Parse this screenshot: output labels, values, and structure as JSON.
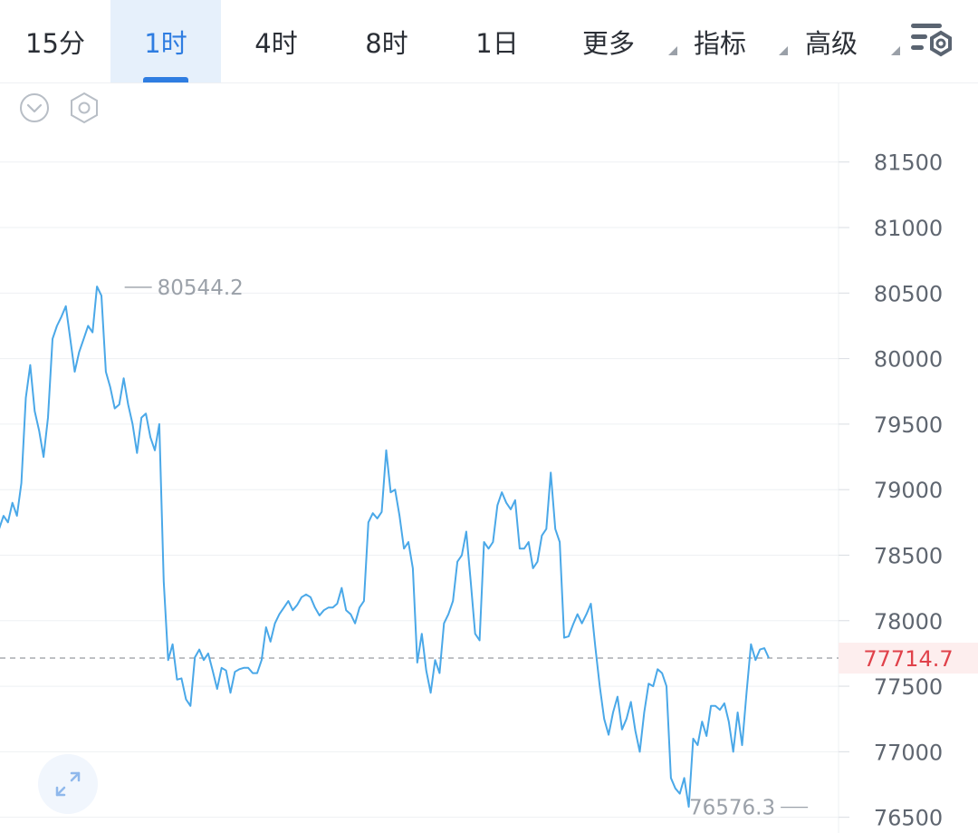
{
  "tabs": [
    {
      "label": "15分",
      "active": false,
      "dropdown": false
    },
    {
      "label": "1时",
      "active": true,
      "dropdown": false
    },
    {
      "label": "4时",
      "active": false,
      "dropdown": false
    },
    {
      "label": "8时",
      "active": false,
      "dropdown": false
    },
    {
      "label": "1日",
      "active": false,
      "dropdown": false
    },
    {
      "label": "更多",
      "active": false,
      "dropdown": true
    },
    {
      "label": "指标",
      "active": false,
      "dropdown": true
    },
    {
      "label": "高级",
      "active": false,
      "dropdown": true
    }
  ],
  "icons": {
    "settings": "chart-settings-icon",
    "collapse": "chevron-down-circle-icon",
    "gear": "hexagon-gear-icon",
    "fullscreen": "expand-arrows-icon"
  },
  "colors": {
    "accent": "#2f7de1",
    "line": "#4aa8e8",
    "current_price": "#e0414a",
    "extreme_label": "#9ba1a9"
  },
  "chart_data": {
    "type": "line",
    "title": "",
    "xlabel": "",
    "ylabel": "",
    "ylim": [
      76380,
      82100
    ],
    "y_ticks": [
      81500,
      81000,
      80500,
      80000,
      79500,
      79000,
      78500,
      78000,
      77500,
      77000,
      76500
    ],
    "grid": true,
    "legend": "none",
    "high": {
      "label": "80544.2",
      "value": 80544.2,
      "index": 27
    },
    "low": {
      "label": "76576.3",
      "value": 76576.3,
      "index": 183
    },
    "current": {
      "label": "77714.7",
      "value": 77714.7
    },
    "series": [
      {
        "values": [
          78700,
          78800,
          78750,
          78900,
          78800,
          79050,
          79700,
          79950,
          79600,
          79450,
          79250,
          79550,
          80150,
          80250,
          80320,
          80400,
          80150,
          79900,
          80050,
          80150,
          80250,
          80200,
          80550,
          80480,
          79900,
          79780,
          79620,
          79650,
          79850,
          79650,
          79500,
          79280,
          79550,
          79580,
          79400,
          79300,
          79500,
          78300,
          77700,
          77820,
          77550,
          77560,
          77400,
          77350,
          77720,
          77780,
          77700,
          77750,
          77620,
          77480,
          77640,
          77620,
          77450,
          77610,
          77630,
          77640,
          77640,
          77600,
          77600,
          77700,
          77950,
          77840,
          77980,
          78050,
          78100,
          78150,
          78080,
          78120,
          78180,
          78200,
          78180,
          78100,
          78040,
          78080,
          78100,
          78100,
          78130,
          78250,
          78080,
          78050,
          77980,
          78100,
          78150,
          78750,
          78820,
          78780,
          78830,
          79300,
          78980,
          79000,
          78800,
          78550,
          78600,
          78400,
          77680,
          77900,
          77620,
          77450,
          77700,
          77600,
          77980,
          78050,
          78150,
          78450,
          78500,
          78680,
          78300,
          77900,
          77850,
          78600,
          78550,
          78600,
          78880,
          78980,
          78900,
          78850,
          78920,
          78550,
          78550,
          78600,
          78400,
          78450,
          78650,
          78700,
          79130,
          78700,
          78600,
          77870,
          77880,
          77970,
          78050,
          77980,
          78050,
          78130,
          77800,
          77500,
          77250,
          77130,
          77300,
          77420,
          77170,
          77250,
          77380,
          77160,
          77000,
          77300,
          77520,
          77500,
          77630,
          77600,
          77500,
          76800,
          76720,
          76680,
          76800,
          76580,
          77100,
          77050,
          77230,
          77120,
          77350,
          77350,
          77320,
          77370,
          77230,
          77000,
          77300,
          77050,
          77450,
          77820,
          77700,
          77780,
          77790,
          77714.7
        ]
      }
    ]
  }
}
